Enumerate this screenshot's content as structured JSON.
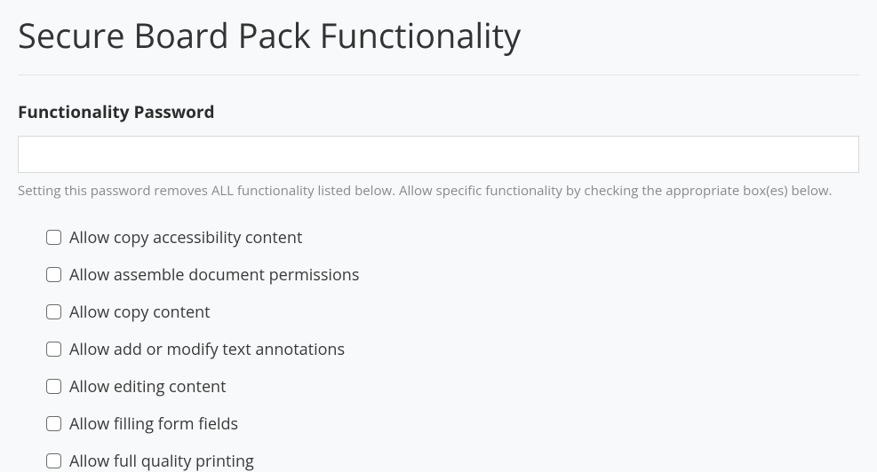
{
  "title": "Secure Board Pack Functionality",
  "password_field": {
    "label": "Functionality Password",
    "value": "",
    "help": "Setting this password removes ALL functionality listed below. Allow specific functionality by checking the appropriate box(es) below."
  },
  "options": [
    {
      "label": "Allow copy accessibility content",
      "checked": false
    },
    {
      "label": "Allow assemble document permissions",
      "checked": false
    },
    {
      "label": "Allow copy content",
      "checked": false
    },
    {
      "label": "Allow add or modify text annotations",
      "checked": false
    },
    {
      "label": "Allow editing content",
      "checked": false
    },
    {
      "label": "Allow filling form fields",
      "checked": false
    },
    {
      "label": "Allow full quality printing",
      "checked": false
    }
  ]
}
